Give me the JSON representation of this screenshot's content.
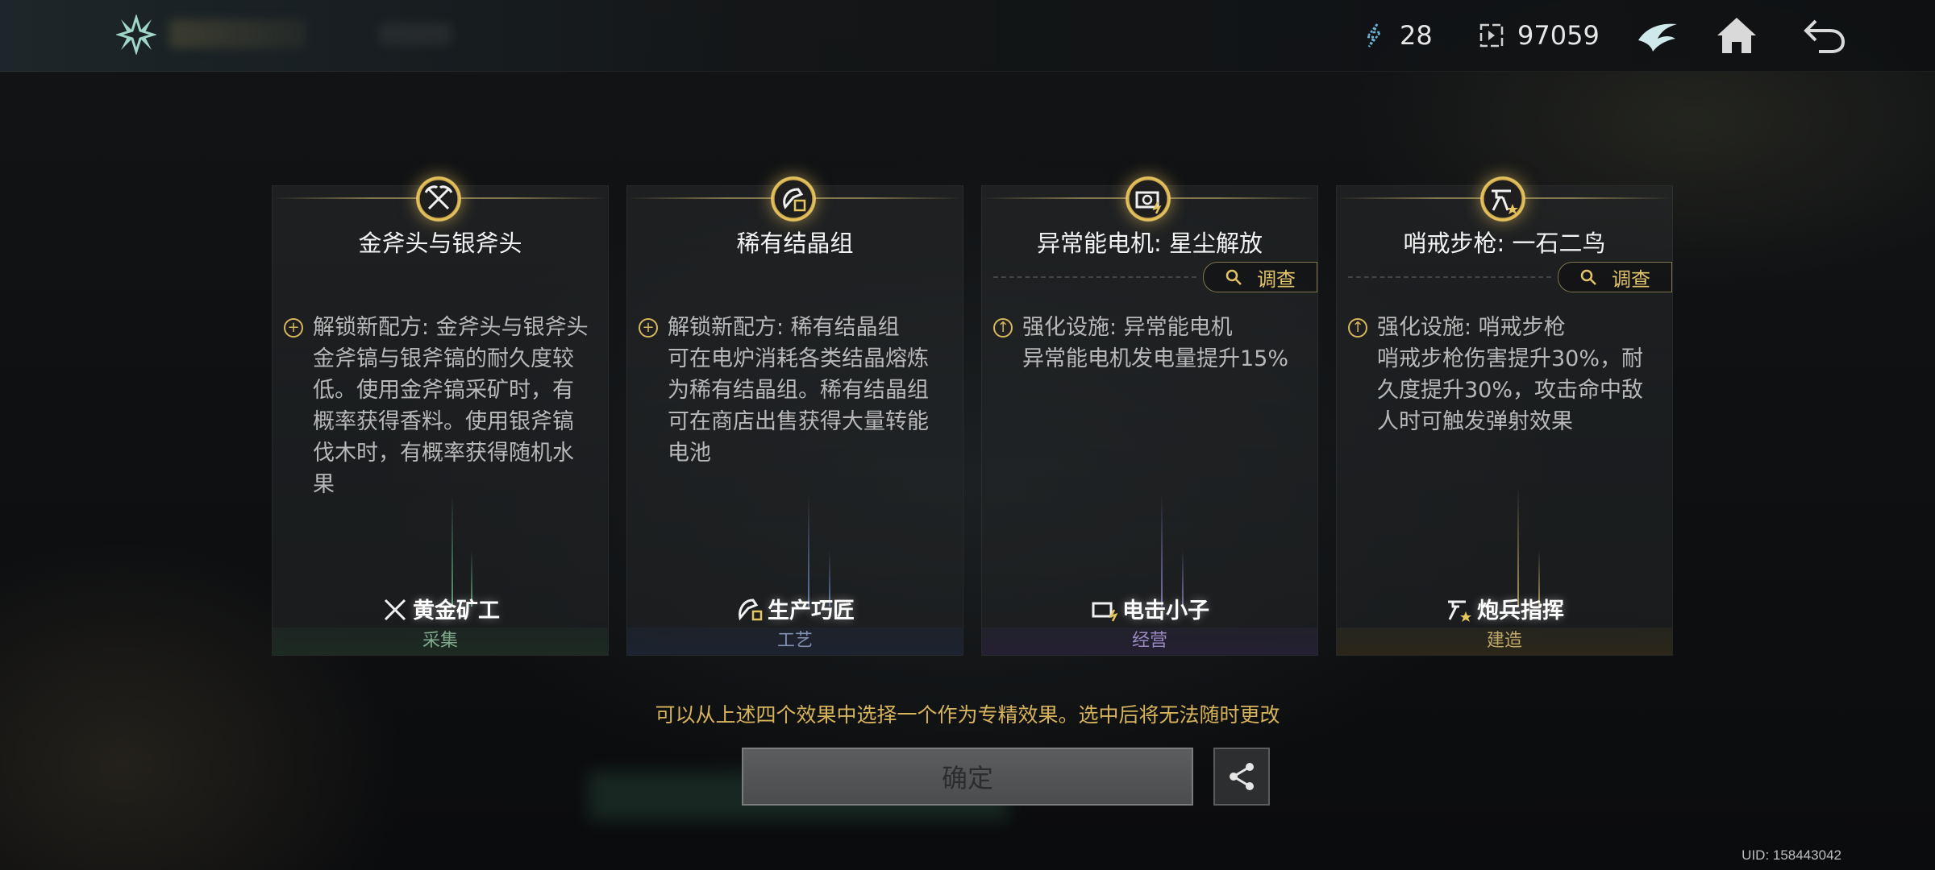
{
  "header": {
    "resource_1": "28",
    "resource_2": "97059"
  },
  "cards": [
    {
      "title": "金斧头与银斧头",
      "show_investigate": false,
      "desc": "解锁新配方: 金斧头与银斧头\n金斧镐与银斧镐的耐久度较低。使用金斧镐采矿时，有概率获得香料。使用银斧镐伐木时，有概率获得随机水果",
      "bullet": "plus",
      "tag": "黄金矿工",
      "category": "采集",
      "category_color": "#7fa98a",
      "category_bg": "#1c2a22",
      "beam_color": "rgba(120,210,160,0.7)"
    },
    {
      "title": "稀有结晶组",
      "show_investigate": false,
      "desc": "解锁新配方: 稀有结晶组\n可在电炉消耗各类结晶熔炼为稀有结晶组。稀有结晶组可在商店出售获得大量转能电池",
      "bullet": "plus",
      "tag": "生产巧匠",
      "category": "工艺",
      "category_color": "#7f8fb0",
      "category_bg": "#1c2230",
      "beam_color": "rgba(130,160,220,0.7)"
    },
    {
      "title": "异常能电机: 星尘解放",
      "show_investigate": true,
      "investigate_label": "调查",
      "desc": "强化设施: 异常能电机\n异常能电机发电量提升15%",
      "bullet": "up",
      "tag": "电击小子",
      "category": "经营",
      "category_color": "#9a88c0",
      "category_bg": "#241f33",
      "beam_color": "rgba(160,150,230,0.7)"
    },
    {
      "title": "哨戒步枪: 一石二鸟",
      "show_investigate": true,
      "investigate_label": "调查",
      "desc": "强化设施: 哨戒步枪\n哨戒步枪伤害提升30%，耐久度提升30%，攻击命中敌人时可触发弹射效果",
      "bullet": "up",
      "tag": "炮兵指挥",
      "category": "建造",
      "category_color": "#bfa86a",
      "category_bg": "#2b2618",
      "beam_color": "rgba(230,200,120,0.7)"
    }
  ],
  "hint": "可以从上述四个效果中选择一个作为专精效果。选中后将无法随时更改",
  "confirm_label": "确定",
  "uid": "UID: 158443042"
}
